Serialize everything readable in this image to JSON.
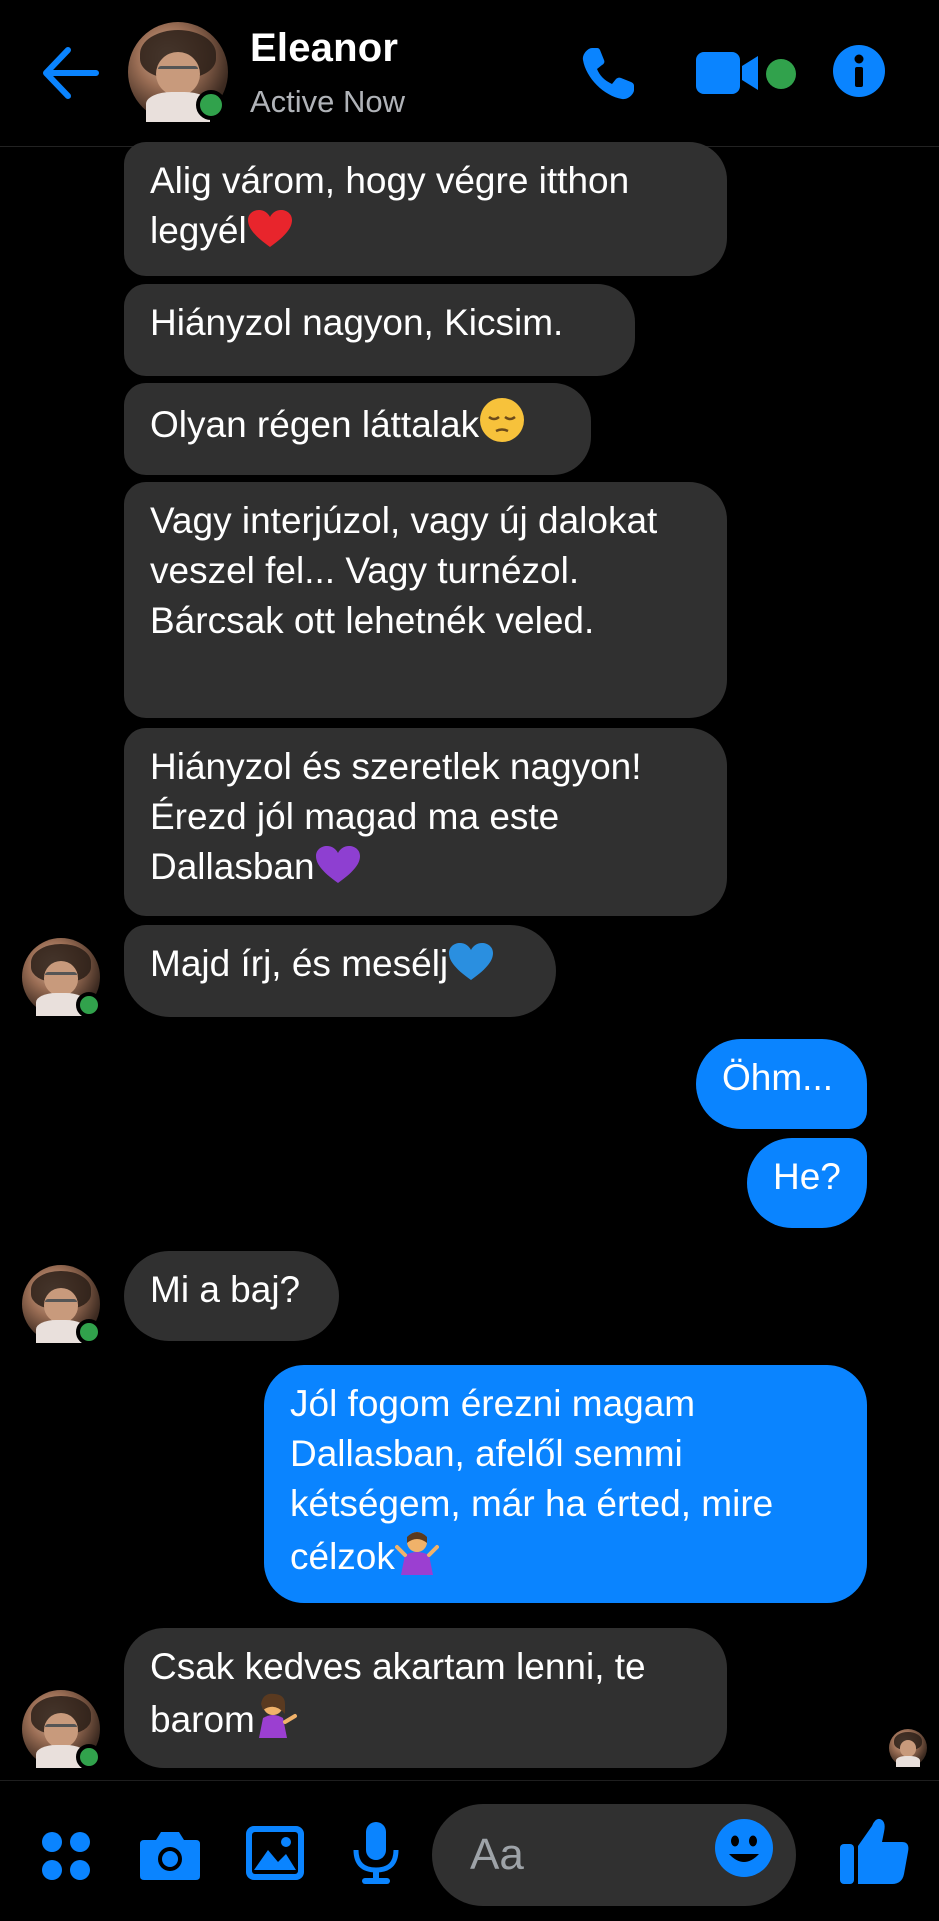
{
  "header": {
    "contact_name": "Eleanor",
    "status": "Active Now"
  },
  "messages": [
    {
      "from": "them",
      "text": "Alig várom, hogy végre itthon legyél",
      "emoji": "red-heart"
    },
    {
      "from": "them",
      "text": "Hiányzol nagyon, Kicsim."
    },
    {
      "from": "them",
      "text": "Olyan régen láttalak",
      "emoji": "pensive-face"
    },
    {
      "from": "them",
      "text": "Vagy interjúzol, vagy új dalokat veszel fel... Vagy turnézol. Bárcsak ott lehetnék veled."
    },
    {
      "from": "them",
      "text": "Hiányzol és szeretlek nagyon! Érezd jól magad ma este Dallasban",
      "emoji": "purple-heart"
    },
    {
      "from": "them",
      "text": "Majd írj, és mesélj",
      "emoji": "blue-heart"
    },
    {
      "from": "me",
      "text": "Öhm..."
    },
    {
      "from": "me",
      "text": "He?"
    },
    {
      "from": "them",
      "text": "Mi a baj?"
    },
    {
      "from": "me",
      "text": "Jól fogom érezni magam Dallasban, afelől semmi kétségem, már ha érted, mire célzok",
      "emoji": "woman-shrugging"
    },
    {
      "from": "them",
      "text": "Csak kedves akartam lenni, te barom",
      "emoji": "woman-tipping-hand"
    }
  ],
  "composer": {
    "placeholder": "Aa"
  },
  "icons": {
    "back": "arrow-left-icon",
    "call": "phone-icon",
    "video": "video-camera-icon",
    "info": "info-icon",
    "menu": "four-dots-icon",
    "camera": "camera-icon",
    "gallery": "image-icon",
    "mic": "microphone-icon",
    "emoji": "smiley-icon",
    "like": "thumbs-up-icon"
  },
  "colors": {
    "accent": "#0a84ff",
    "incoming_bubble": "#303030",
    "online": "#31a24c",
    "background": "#000000"
  }
}
